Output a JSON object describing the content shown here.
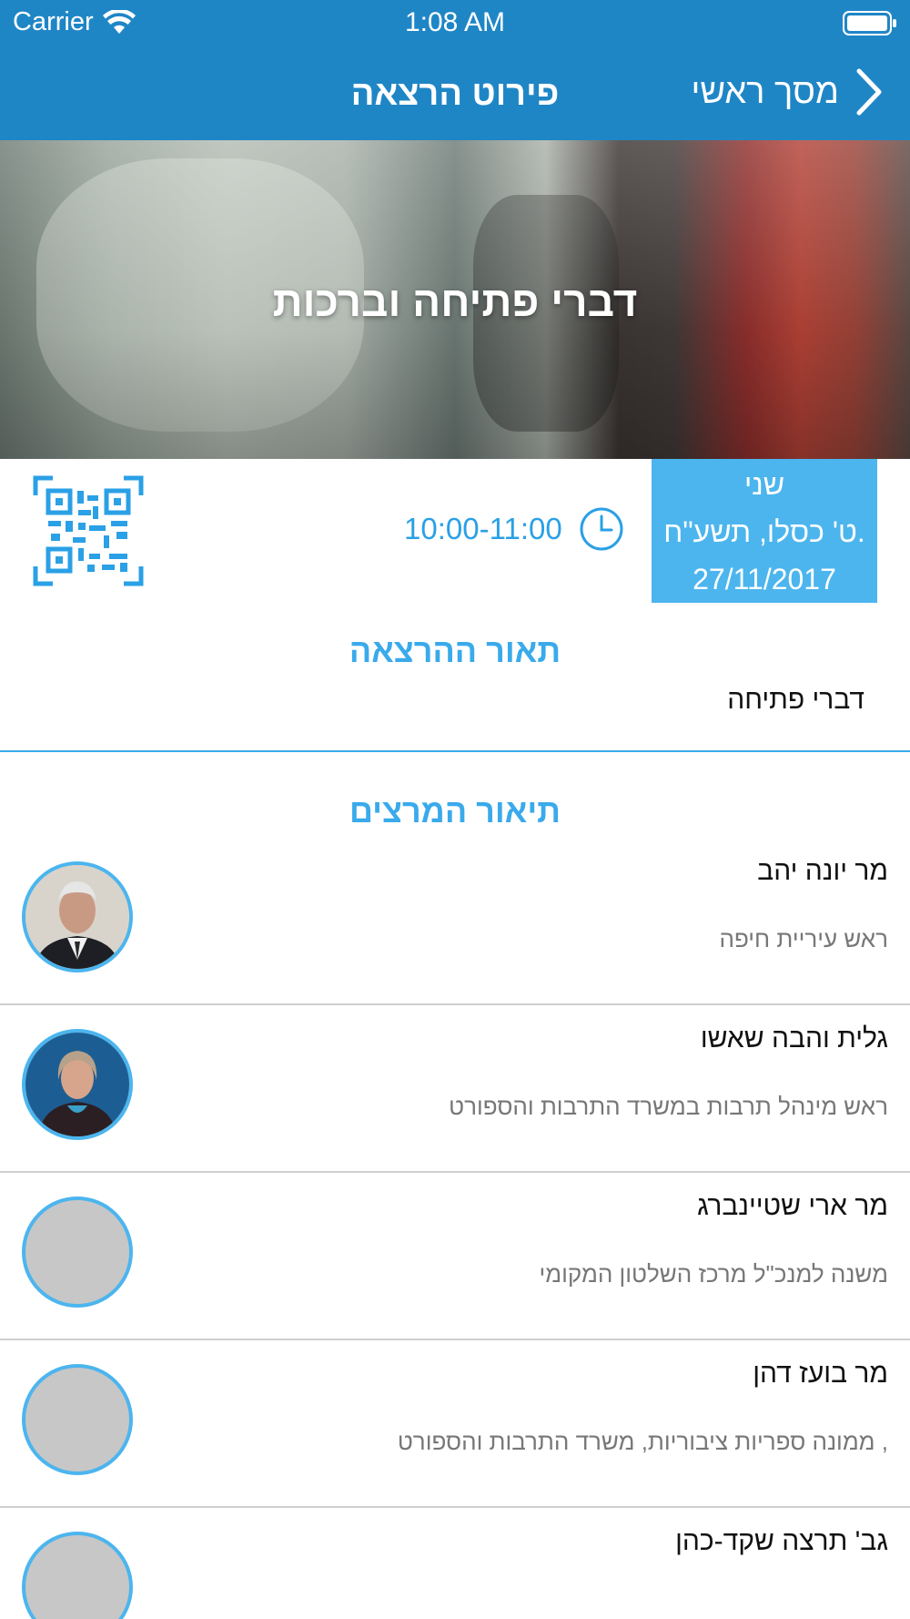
{
  "status_bar": {
    "carrier": "Carrier",
    "time": "1:08 AM"
  },
  "nav": {
    "title": "פירוט הרצאה",
    "back_label": "מסך ראשי"
  },
  "hero": {
    "title": "דברי פתיחה וברכות"
  },
  "info": {
    "day": "שני",
    "hebrew_date": "ט' כסלו, תשע\"ח.",
    "date": "27/11/2017",
    "time": "10:00-11:00"
  },
  "description": {
    "title": "תאור ההרצאה",
    "text": "דברי פתיחה"
  },
  "speakers_section": {
    "title": "תיאור המרצים"
  },
  "speakers": [
    {
      "name": "מר יונה יהב",
      "role": "ראש עיריית חיפה",
      "photo": "portrait-man"
    },
    {
      "name": "גלית והבה שאשו",
      "role": "ראש מינהל תרבות במשרד התרבות והספורט",
      "photo": "portrait-woman"
    },
    {
      "name": "מר ארי שטיינברג",
      "role": "משנה למנכ\"ל מרכז השלטון המקומי",
      "photo": "placeholder"
    },
    {
      "name": "מר בועז דהן",
      "role": ", ממונה ספריות ציבוריות, משרד התרבות והספורט",
      "photo": "placeholder"
    },
    {
      "name": "גב' תרצה שקד-כהן",
      "role": "",
      "photo": "placeholder"
    }
  ],
  "colors": {
    "nav_bg": "#1f86c6",
    "accent": "#3aaaeb",
    "date_box": "#4cb5ee"
  }
}
